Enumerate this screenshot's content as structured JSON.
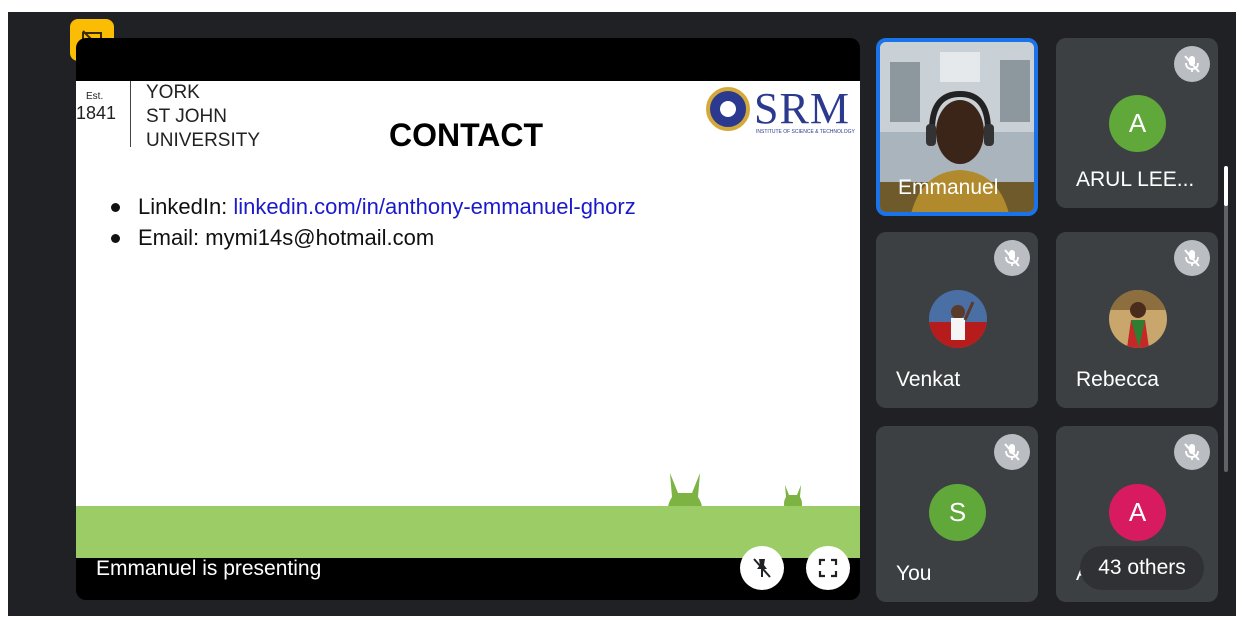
{
  "presentation": {
    "slide": {
      "est": "Est.",
      "year": "1841",
      "university_lines": [
        "YORK",
        "ST JOHN",
        "UNIVERSITY"
      ],
      "title": "CONTACT",
      "srm_logo": "SRM",
      "srm_subtitle": "INSTITUTE OF SCIENCE & TECHNOLOGY",
      "bullets": [
        {
          "label": "LinkedIn: ",
          "value": "linkedin.com/in/anthony-emmanuel-ghorz"
        },
        {
          "label": "Email: ",
          "value": "mymi14s@hotmail.com"
        }
      ]
    },
    "status_text": "Emmanuel is presenting",
    "badge_icon": "no-pip-icon",
    "unpin_icon": "unpin-icon",
    "fullscreen_icon": "fullscreen-icon"
  },
  "participants": [
    {
      "name": "Emmanuel",
      "type": "video",
      "muted": false,
      "active_speaker": true
    },
    {
      "name": "ARUL LEE...",
      "initial": "A",
      "color": "#5fa839",
      "muted": true
    },
    {
      "name": "Venkat",
      "type": "photo",
      "muted": true
    },
    {
      "name": "Rebecca",
      "type": "photo",
      "muted": true
    },
    {
      "name": "You",
      "initial": "S",
      "color": "#5fa839",
      "muted": true
    },
    {
      "name": "AB",
      "initial": "A",
      "color": "#d81b60",
      "muted": true
    }
  ],
  "others_label": "43 others",
  "colors": {
    "active_border": "#1a73e8",
    "tile_bg": "#3c4043",
    "badge": "#fbbc04"
  }
}
